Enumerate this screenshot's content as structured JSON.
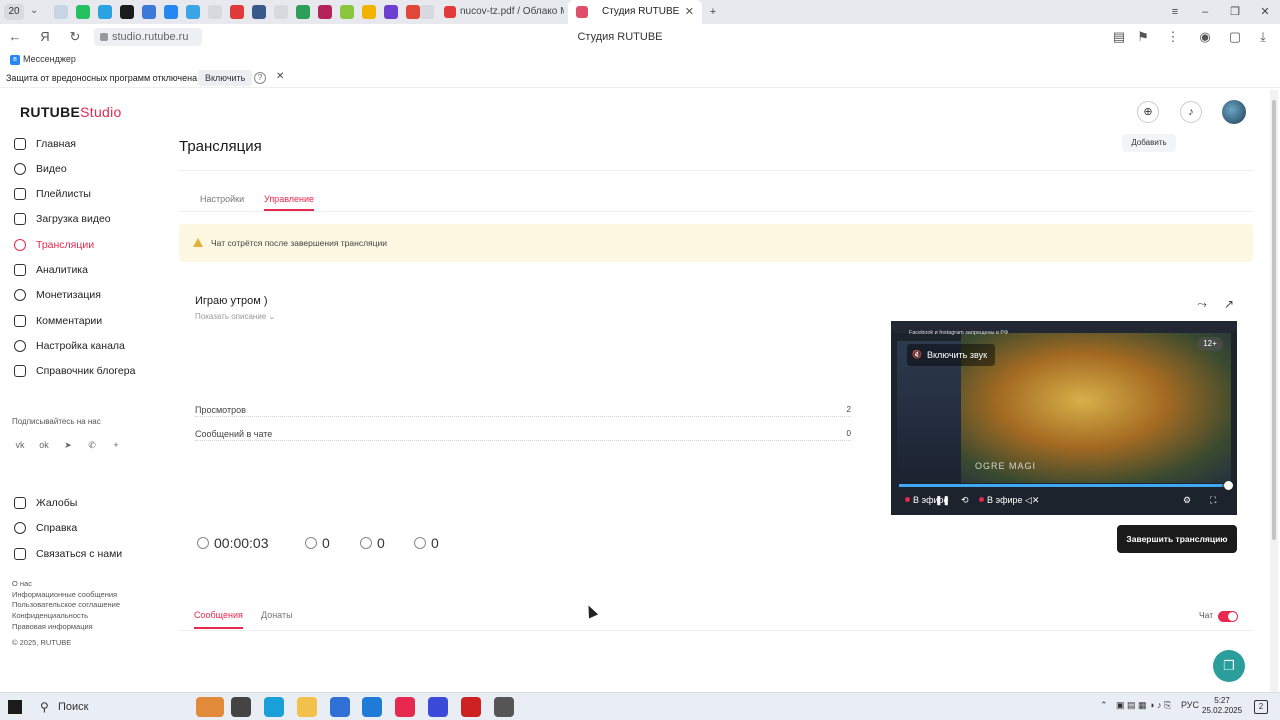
{
  "browser": {
    "tab_count": "20",
    "tabs": [
      {
        "title": "nucov-tz.pdf / Облако Mail",
        "active": false
      },
      {
        "title": "Студия RUTUBE",
        "active": true
      }
    ],
    "url": "studio.rutube.ru",
    "page_title": "Студия RUTUBE",
    "bookmark": "Мессенджер",
    "protection_notice": "Защита от вредоносных программ отключена",
    "protection_button": "Включить"
  },
  "app": {
    "logo_main": "RUTUBE",
    "logo_sub": "Studio",
    "header": {
      "add_tooltip": "Добавить"
    },
    "sidebar": {
      "items": [
        {
          "label": "Главная",
          "icon": "home-icon",
          "active": false
        },
        {
          "label": "Видео",
          "icon": "video-icon",
          "active": false
        },
        {
          "label": "Плейлисты",
          "icon": "playlist-icon",
          "active": false
        },
        {
          "label": "Загрузка видео",
          "icon": "upload-icon",
          "active": false
        },
        {
          "label": "Трансляции",
          "icon": "broadcast-icon",
          "active": true
        },
        {
          "label": "Аналитика",
          "icon": "analytics-icon",
          "active": false
        },
        {
          "label": "Монетизация",
          "icon": "money-icon",
          "active": false
        },
        {
          "label": "Комментарии",
          "icon": "comment-icon",
          "active": false
        },
        {
          "label": "Настройка канала",
          "icon": "settings-icon",
          "active": false
        },
        {
          "label": "Справочник блогера",
          "icon": "book-icon",
          "active": false
        }
      ],
      "subscribe_label": "Подписывайтесь на нас",
      "social": [
        "vk",
        "ok",
        "telegram",
        "viber",
        "more"
      ],
      "support_items": [
        {
          "label": "Жалобы",
          "icon": "flag-icon"
        },
        {
          "label": "Справка",
          "icon": "help-icon"
        },
        {
          "label": "Связаться с нами",
          "icon": "mail-icon"
        }
      ],
      "footer_links": [
        "О нас",
        "Информационные сообщения",
        "Пользовательское соглашение",
        "Конфиденциальность",
        "Правовая информация"
      ],
      "copyright": "© 2025, RUTUBE"
    },
    "page_title": "Трансляция",
    "tabs": [
      {
        "label": "Настройки",
        "active": false
      },
      {
        "label": "Управление",
        "active": true
      }
    ],
    "warning": "Чат сотрётся после завершения трансляции",
    "stream": {
      "title": "Играю утром )",
      "show_description": "Показать описание",
      "stats": [
        {
          "label": "Просмотров",
          "value": "2"
        },
        {
          "label": "Сообщений в чате",
          "value": "0"
        }
      ],
      "duration": "00:00:03",
      "viewers": "0",
      "likes": "0",
      "dislikes": "0",
      "end_button": "Завершить трансляцию"
    },
    "player": {
      "notice": "Facebook и Instagram запрещены в РФ",
      "unmute_label": "Включить звук",
      "age_rating": "12+",
      "hero_caption": "OGRE MAGI",
      "live_label": "В эфире",
      "live_label_2": "В эфире",
      "progress": 0.98
    },
    "messages": {
      "tabs": [
        {
          "label": "Сообщения",
          "active": true
        },
        {
          "label": "Донаты",
          "active": false
        }
      ],
      "chat_label": "Чат",
      "chat_enabled": true
    }
  },
  "taskbar": {
    "search_label": "Поиск",
    "lang": "РУС",
    "time": "5:27",
    "date": "25.02.2025",
    "notifications": "2"
  },
  "colors": {
    "accent": "#e8294f",
    "warning_bg": "#fdf8e2",
    "button_dark": "#1b1b1b",
    "help_fab": "#2a9e9a"
  }
}
